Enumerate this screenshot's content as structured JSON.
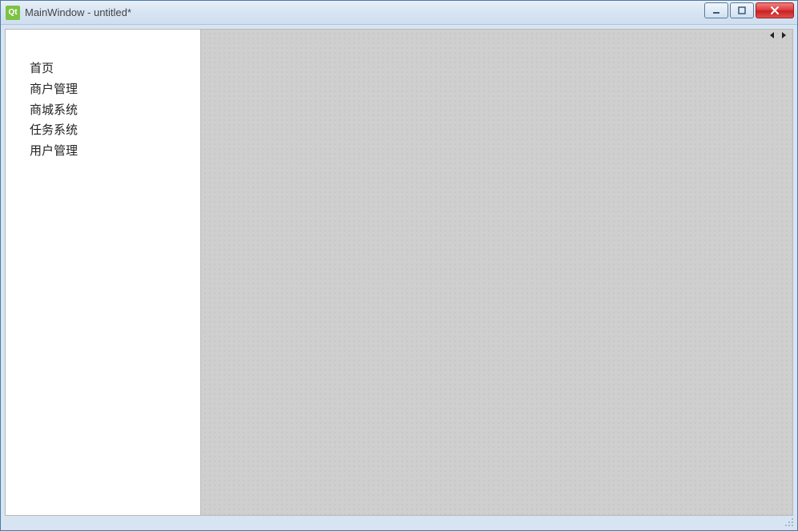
{
  "window": {
    "title": "MainWindow - untitled*",
    "app_icon_text": "Qt"
  },
  "sidebar": {
    "items": [
      {
        "label": "首页"
      },
      {
        "label": "商户管理"
      },
      {
        "label": "商城系统"
      },
      {
        "label": "任务系统"
      },
      {
        "label": "用户管理"
      }
    ]
  }
}
